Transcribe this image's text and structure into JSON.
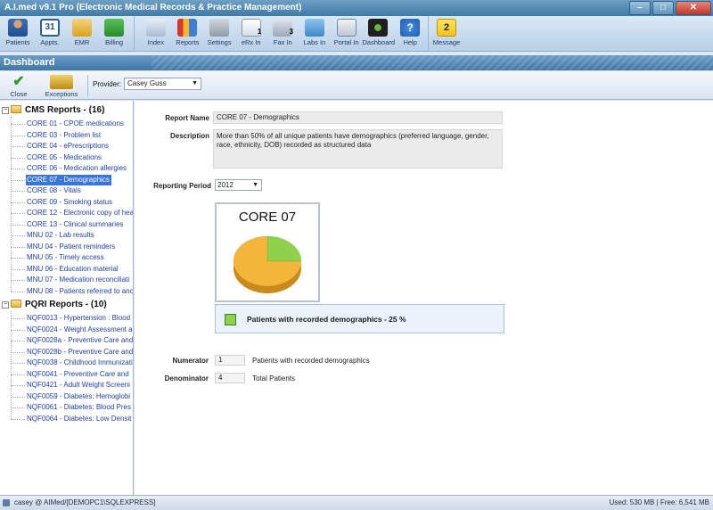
{
  "window": {
    "title": "A.I.med v9.1 Pro (Electronic Medical Records & Practice Management)",
    "minimize": "–",
    "maximize": "□",
    "close": "✕"
  },
  "toolbar": {
    "items": [
      {
        "label": "Patients",
        "icon": "patients-icon"
      },
      {
        "label": "Appts.",
        "icon": "calendar-icon",
        "glyph": "31"
      },
      {
        "label": "EMR",
        "icon": "folder-icon"
      },
      {
        "label": "Billing",
        "icon": "billing-icon"
      },
      {
        "label": "Index",
        "icon": "index-icon"
      },
      {
        "label": "Reports",
        "icon": "reports-icon"
      },
      {
        "label": "Settings",
        "icon": "settings-icon"
      },
      {
        "label": "eRx In",
        "icon": "erx-icon",
        "badge": "1"
      },
      {
        "label": "Fax In",
        "icon": "fax-icon",
        "badge": "3"
      },
      {
        "label": "Labs In",
        "icon": "labs-icon"
      },
      {
        "label": "Portal In",
        "icon": "portal-icon"
      },
      {
        "label": "Dashboard",
        "icon": "dashboard-icon"
      },
      {
        "label": "Help",
        "icon": "help-icon",
        "glyph": "?"
      },
      {
        "label": "Message",
        "icon": "message-icon",
        "glyph": "2"
      }
    ]
  },
  "header": {
    "title": "Dashboard"
  },
  "subbar": {
    "close_label": "Close",
    "exceptions_label": "Exceptions",
    "provider_label": "Provider:",
    "provider_value": "Casey Guss"
  },
  "tree": {
    "groups": [
      {
        "label": "CMS Reports - (16)",
        "toggle": "−",
        "items": [
          "CORE 01 - CPOE medications",
          "CORE 03 - Problem list",
          "CORE 04 - ePrescriptions",
          "CORE 05 - Medications",
          "CORE 06 - Medication allergies",
          "CORE 07 - Demographics",
          "CORE 08 - Vitals",
          "CORE 09 - Smoking status",
          "CORE 12 - Electronic copy of hea",
          "CORE 13 - Clinical summaries",
          "MNU 02 - Lab results",
          "MNU 04 - Patient reminders",
          "MNU 05 - Timely access",
          "MNU 06 - Education material",
          "MNU 07 - Medication reconciliati",
          "MNU 08 - Patients referred to ano"
        ]
      },
      {
        "label": "PQRI Reports - (10)",
        "toggle": "−",
        "items": [
          "NQF0013 - Hypertension : Blood",
          "NQF0024 - Weight Assessment a",
          "NQF0028a - Preventive Care and",
          "NQF0028b - Preventive Care and",
          "NQF0038 - Childhood Immunizati",
          "NQF0041 - Preventive Care and",
          "NQF0421 - Adult Weight Screeni",
          "NQF0059 - Diabetes: Hemoglobi",
          "NQF0061 - Diabetes: Blood Pres",
          "NQF0064 - Diabetes: Low Densit"
        ]
      }
    ],
    "selected": "CORE 07 - Demographics"
  },
  "report": {
    "name_label": "Report Name",
    "name_value": "CORE 07 - Demographics",
    "description_label": "Description",
    "description_value": "More than 50% of all unique patients have demographics (preferred language, gender, race, ethnicity, DOB) recorded as structured data",
    "period_label": "Reporting Period",
    "period_value": "2012",
    "chart_title": "CORE 07",
    "legend_text": "Patients with recorded demographics - 25 %",
    "numerator_label": "Numerator",
    "numerator_value": "1",
    "numerator_desc": "Patients with recorded demographics",
    "denominator_label": "Denominator",
    "denominator_value": "4",
    "denominator_desc": "Total Patients"
  },
  "chart_data": {
    "type": "pie",
    "title": "CORE 07",
    "slices": [
      {
        "label": "Patients with recorded demographics",
        "value": 25,
        "color": "#8fd14a"
      },
      {
        "label": "",
        "value": 75,
        "color": "#f2b63b"
      }
    ]
  },
  "status": {
    "left": "casey @ AIMed/[DEMOPC1\\SQLEXPRESS]",
    "right": "Used: 530 MB | Free: 6,541 MB"
  }
}
